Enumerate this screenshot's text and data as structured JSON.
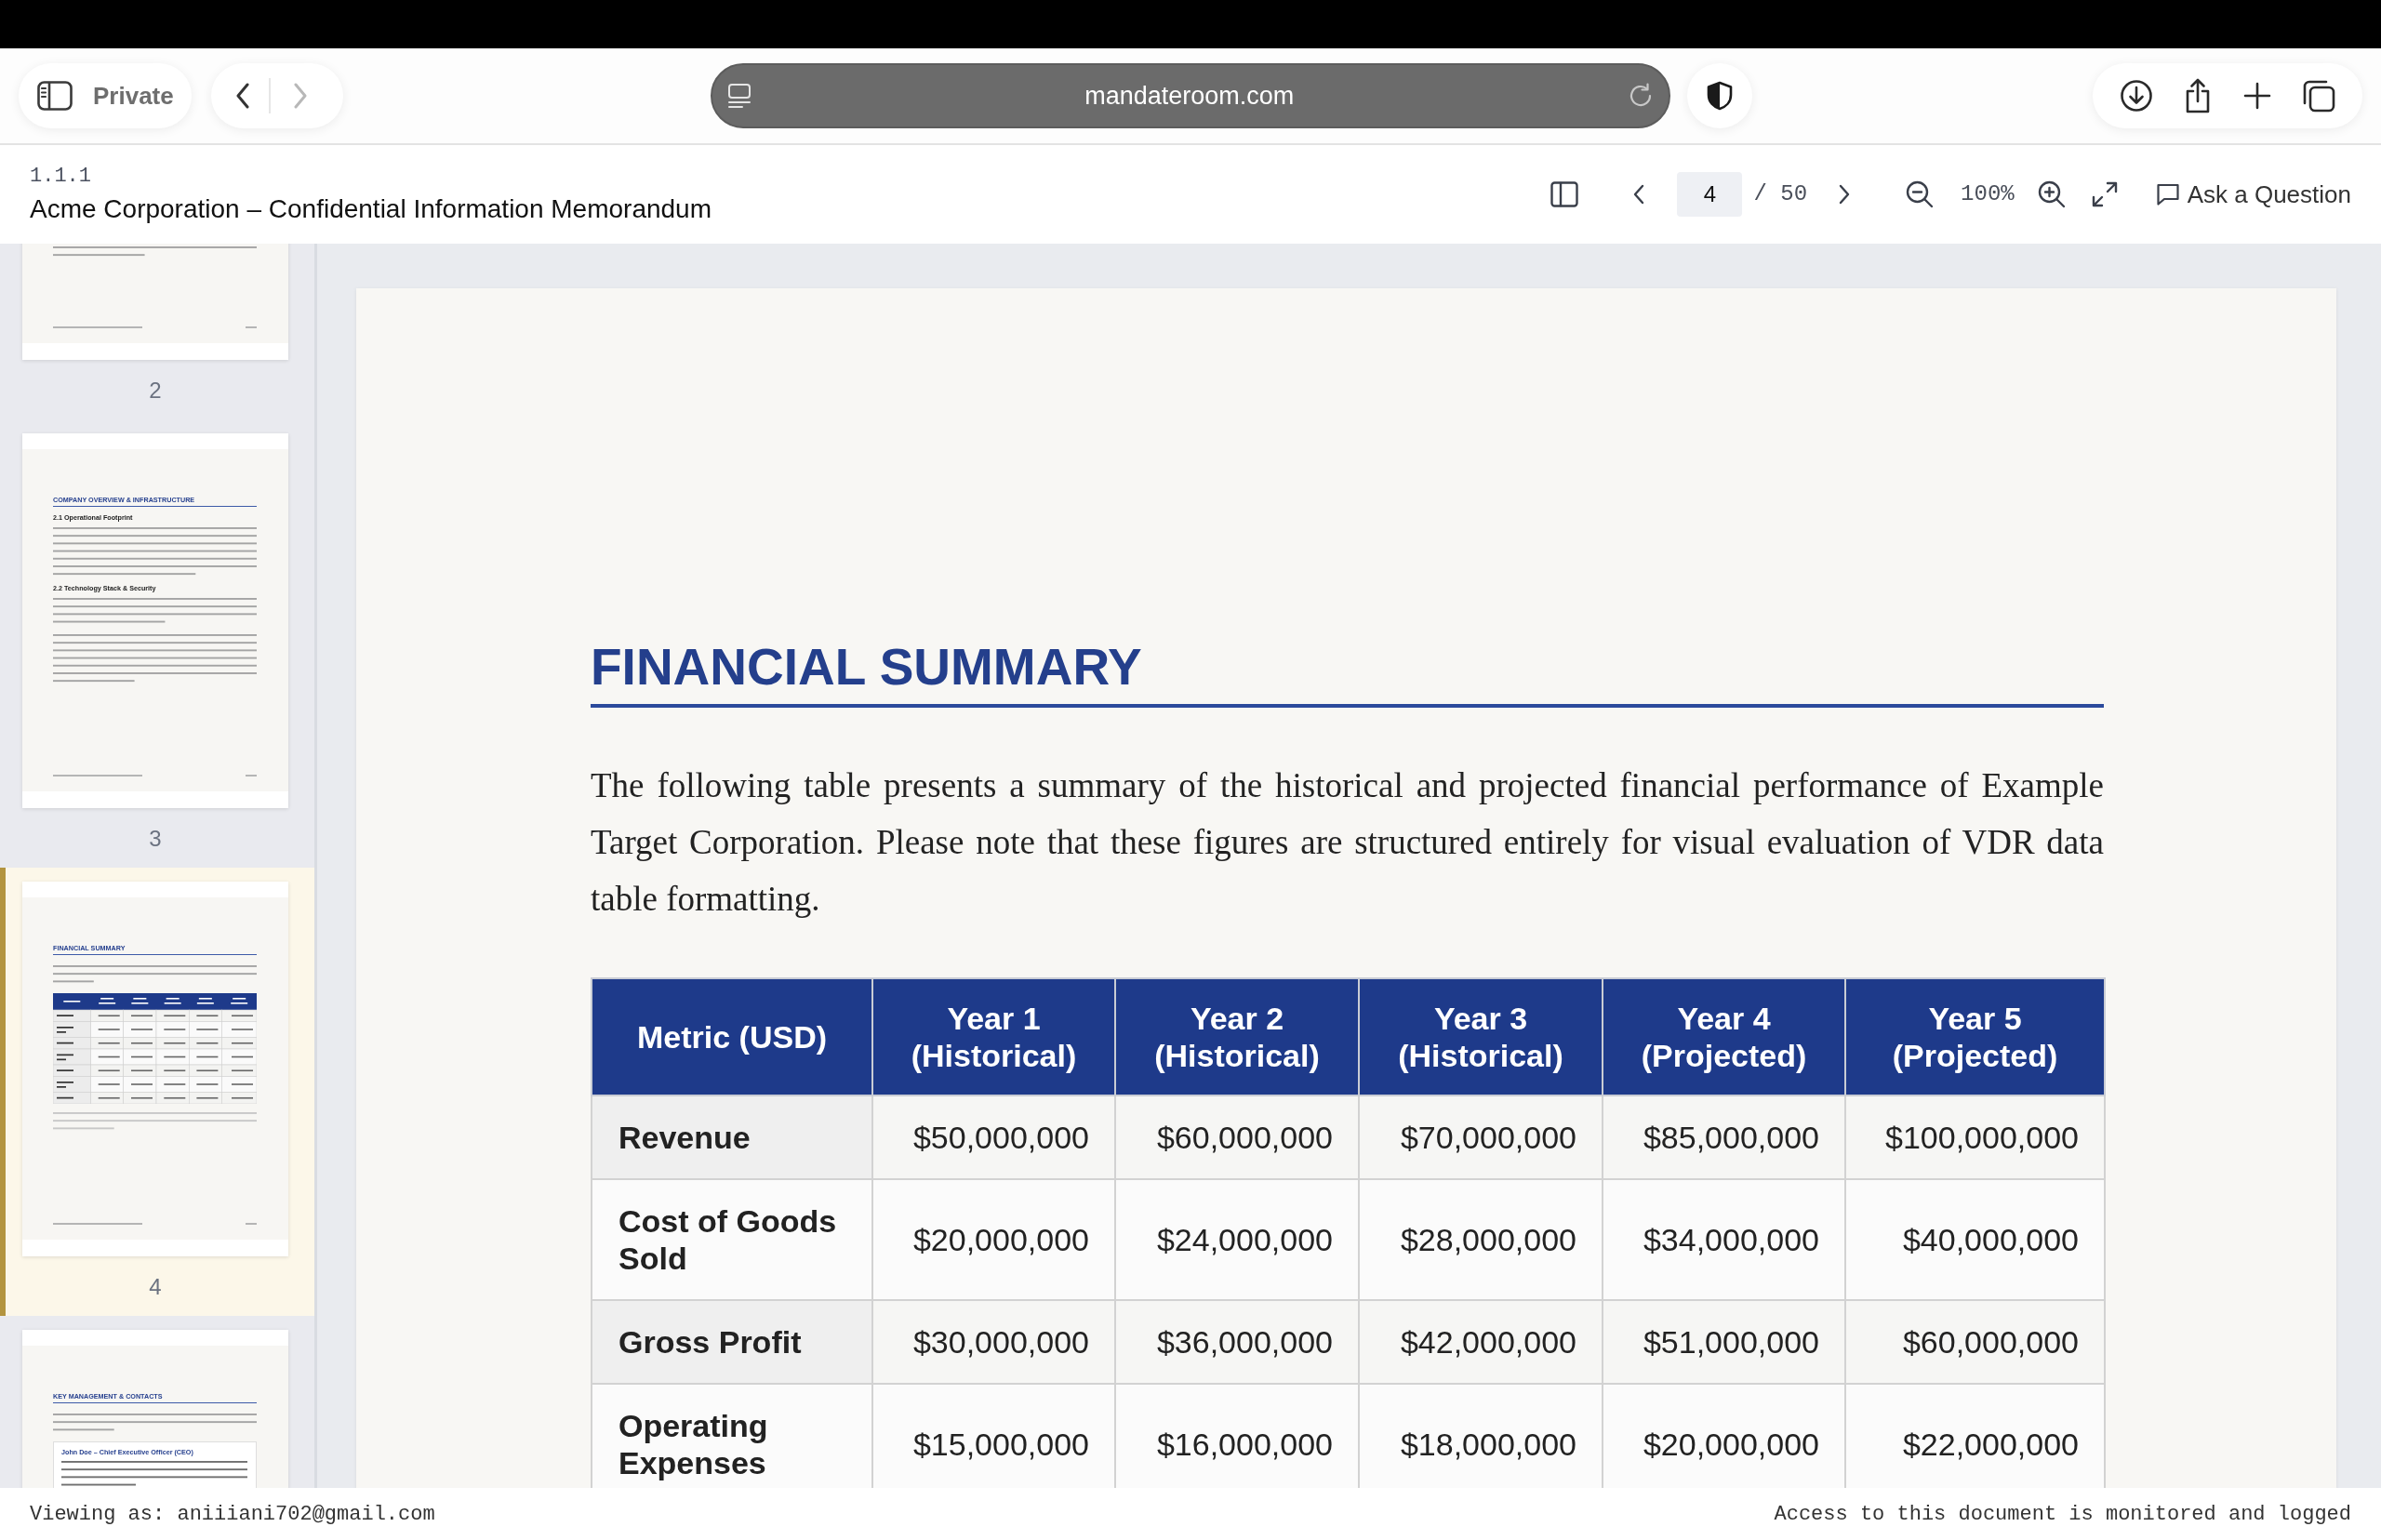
{
  "browser": {
    "sidebar_button": "Private",
    "nav": [
      {
        "kind": "back",
        "disabled": false
      },
      {
        "kind": "forward",
        "disabled": true
      }
    ],
    "url": "mandateroom.com"
  },
  "document_header": {
    "version": "1.1.1",
    "title": "Acme Corporation – Confidential Information Memorandum"
  },
  "viewer_toolbar": {
    "page": "4",
    "page_count": "/ 50",
    "zoom": "100%",
    "ask_button": "Ask a Question"
  },
  "thumbnails": [
    {
      "kind": "text",
      "label": "2",
      "selected": false
    },
    {
      "kind": "overview",
      "label": "3",
      "selected": false,
      "heading": "COMPANY OVERVIEW & INFRASTRUCTURE",
      "subheadings": [
        "2.1 Operational Footprint",
        "2.2 Technology Stack & Security"
      ]
    },
    {
      "kind": "table",
      "label": "4",
      "selected": true,
      "heading": "FINANCIAL SUMMARY"
    },
    {
      "kind": "contacts",
      "selected": false,
      "heading": "KEY MANAGEMENT & CONTACTS",
      "contact": "John Doe – Chief Executive Officer (CEO)"
    }
  ],
  "page": {
    "heading": "FINANCIAL SUMMARY",
    "paragraph": "The following table presents a summary of the historical and projected financial performance of Example Target Corporation. Please note that these figures are structured entirely for visual evaluation of VDR data table formatting.",
    "table": {
      "columns": [
        "Metric (USD)",
        "Year 1 (Historical)",
        "Year 2 (Historical)",
        "Year 3 (Historical)",
        "Year 4 (Projected)",
        "Year 5 (Projected)"
      ],
      "rows": [
        [
          "Revenue",
          "$50,000,000",
          "$60,000,000",
          "$70,000,000",
          "$85,000,000",
          "$100,000,000"
        ],
        [
          "Cost of Goods Sold",
          "$20,000,000",
          "$24,000,000",
          "$28,000,000",
          "$34,000,000",
          "$40,000,000"
        ],
        [
          "Gross Profit",
          "$30,000,000",
          "$36,000,000",
          "$42,000,000",
          "$51,000,000",
          "$60,000,000"
        ],
        [
          "Operating Expenses",
          "$15,000,000",
          "$16,000,000",
          "$18,000,000",
          "$20,000,000",
          "$22,000,000"
        ]
      ]
    }
  },
  "status_bar": {
    "viewer": "Viewing as: aniiiani702@gmail.com",
    "notice": "Access to this document is monitored and logged"
  }
}
